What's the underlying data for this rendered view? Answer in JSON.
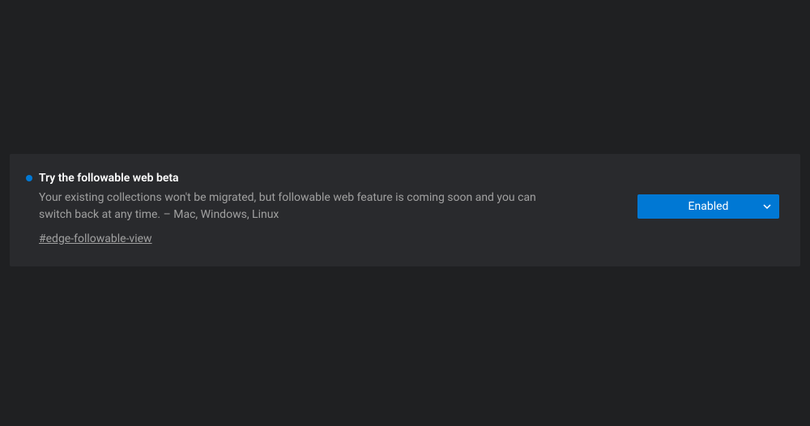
{
  "flag": {
    "title": "Try the followable web beta",
    "description": "Your existing collections won't be migrated, but followable web feature is coming soon and you can switch back at any time. – Mac, Windows, Linux",
    "tag": "#edge-followable-view",
    "indicator_color": "#0078d4"
  },
  "dropdown": {
    "selected": "Enabled"
  }
}
